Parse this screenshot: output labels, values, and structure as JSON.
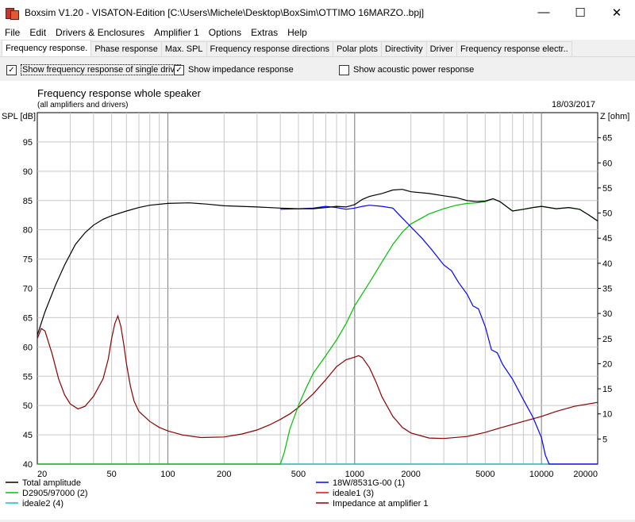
{
  "window": {
    "title": "Boxsim V1.20 - VISATON-Edition [C:\\Users\\Michele\\Desktop\\BoxSim\\OTTIMO 16MARZO..bpj]",
    "minimize": "—",
    "maximize": "☐",
    "close": "✕"
  },
  "menu": [
    "File",
    "Edit",
    "Drivers & Enclosures",
    "Amplifier 1",
    "Options",
    "Extras",
    "Help"
  ],
  "tabs": [
    {
      "label": "Frequency response.",
      "active": true
    },
    {
      "label": "Phase response",
      "active": false
    },
    {
      "label": "Max. SPL",
      "active": false
    },
    {
      "label": "Frequency response directions",
      "active": false
    },
    {
      "label": "Polar plots",
      "active": false
    },
    {
      "label": "Directivity",
      "active": false
    },
    {
      "label": "Driver",
      "active": false
    },
    {
      "label": "Frequency response electr..",
      "active": false
    }
  ],
  "options": [
    {
      "label": "Show frequency response of single drive",
      "checked": true
    },
    {
      "label": "Show impedance response",
      "checked": true
    },
    {
      "label": "Show acoustic power response",
      "checked": false
    }
  ],
  "checkmark": "✓",
  "chart_data": {
    "type": "line",
    "title": "Frequency response whole speaker",
    "subtitle": "(all amplifiers and drivers)",
    "date": "18/03/2017",
    "ylabel": "SPL [dB]",
    "y2label": "Z [ohm]",
    "xscale": "log",
    "xlim": [
      20,
      20000
    ],
    "ylim": [
      40,
      100
    ],
    "y2lim": [
      0,
      70
    ],
    "grid": true,
    "x_ticks": [
      20,
      50,
      100,
      200,
      500,
      1000,
      2000,
      5000,
      10000,
      20000
    ],
    "x_tick_labels": [
      "20",
      "50",
      "100",
      "200",
      "500",
      "1000",
      "2000",
      "5000",
      "10000",
      "20000"
    ],
    "y_ticks": [
      40,
      45,
      50,
      55,
      60,
      65,
      70,
      75,
      80,
      85,
      90,
      95
    ],
    "y_tick_labels": [
      "40",
      "45",
      "50",
      "55",
      "60",
      "65",
      "70",
      "75",
      "80",
      "85",
      "90",
      "95"
    ],
    "y2_ticks": [
      5,
      10,
      15,
      20,
      25,
      30,
      35,
      40,
      45,
      50,
      55,
      60,
      65
    ],
    "y2_tick_labels": [
      "5",
      "10",
      "15",
      "20",
      "25",
      "30",
      "35",
      "40",
      "45",
      "50",
      "55",
      "60",
      "65"
    ],
    "series": [
      {
        "name": "Total amplitude",
        "color": "#000000",
        "axis": "left",
        "x": [
          20,
          22,
          25,
          28,
          32,
          36,
          40,
          45,
          50,
          60,
          70,
          80,
          100,
          130,
          160,
          200,
          300,
          400,
          500,
          600,
          700,
          800,
          900,
          1000,
          1100,
          1200,
          1400,
          1600,
          1800,
          2000,
          2500,
          3000,
          3500,
          4000,
          4500,
          5000,
          5500,
          6000,
          7000,
          8000,
          9000,
          10000,
          12000,
          14000,
          16000,
          18000,
          20000
        ],
        "y": [
          62,
          66,
          70.5,
          74,
          77.5,
          79.5,
          80.8,
          81.8,
          82.4,
          83.2,
          83.8,
          84.2,
          84.5,
          84.6,
          84.4,
          84.1,
          83.9,
          83.7,
          83.6,
          83.6,
          83.8,
          84,
          83.9,
          84.3,
          85.2,
          85.7,
          86.2,
          86.8,
          86.9,
          86.5,
          86.2,
          85.8,
          85.5,
          85,
          84.8,
          84.9,
          85.3,
          84.8,
          83.2,
          83.5,
          83.8,
          84,
          83.6,
          83.8,
          83.5,
          82.5,
          81.5
        ]
      },
      {
        "name": "18W/8531G-00 (1)",
        "color": "#0000ff",
        "axis": "left",
        "x": [
          400,
          500,
          600,
          700,
          800,
          900,
          1000,
          1100,
          1200,
          1400,
          1600,
          1800,
          2000,
          2300,
          2600,
          3000,
          3300,
          3600,
          4000,
          4300,
          4600,
          5000,
          5400,
          5800,
          6200,
          7000,
          8000,
          9000,
          10000,
          10500,
          11000,
          12000,
          20000
        ],
        "y": [
          83.5,
          83.6,
          83.7,
          84,
          83.8,
          83.5,
          83.7,
          84,
          84.2,
          84,
          83.7,
          82,
          80.5,
          78.5,
          76.5,
          74,
          73,
          71,
          69,
          67,
          66.5,
          63.5,
          59.5,
          59,
          57,
          54.5,
          51,
          48,
          44.5,
          41.5,
          40,
          40,
          40
        ]
      },
      {
        "name": "D2905/97000 (2)",
        "color": "#00c000",
        "axis": "left",
        "x": [
          20,
          400,
          420,
          450,
          500,
          550,
          600,
          700,
          800,
          900,
          1000,
          1200,
          1400,
          1600,
          1800,
          2000,
          2500,
          3000,
          3500,
          4000,
          4500,
          5000,
          5500,
          6000,
          7000,
          8000,
          9000,
          10000,
          12000,
          14000,
          16000,
          18000,
          20000
        ],
        "y": [
          40,
          40,
          42,
          46,
          50,
          53,
          55.5,
          58.5,
          61.2,
          64,
          67,
          71,
          74.5,
          77.5,
          79.6,
          81,
          82.7,
          83.6,
          84.2,
          84.5,
          84.6,
          84.8,
          85.3,
          84.8,
          83.2,
          83.5,
          83.8,
          84,
          83.6,
          83.8,
          83.5,
          82.5,
          81.5
        ]
      },
      {
        "name": "ideale1 (3)",
        "color": "#ff0000",
        "axis": "left",
        "x": [
          20,
          20000
        ],
        "y": [
          40,
          40
        ]
      },
      {
        "name": "ideale2 (4)",
        "color": "#00c8c8",
        "axis": "left",
        "x": [
          20,
          20000
        ],
        "y": [
          40,
          40
        ]
      },
      {
        "name": "Impedance at amplifier 1",
        "color": "#8b0000",
        "axis": "right",
        "x": [
          20,
          21,
          22,
          24,
          26,
          28,
          30,
          33,
          36,
          40,
          45,
          48,
          50,
          52,
          54,
          56,
          58,
          60,
          63,
          66,
          70,
          80,
          90,
          100,
          120,
          150,
          200,
          250,
          300,
          350,
          400,
          450,
          500,
          600,
          700,
          800,
          900,
          1000,
          1050,
          1100,
          1200,
          1300,
          1400,
          1600,
          1800,
          2000,
          2500,
          3000,
          4000,
          5000,
          6000,
          8000,
          10000,
          12000,
          15000,
          20000
        ],
        "y": [
          25,
          27,
          26.5,
          22,
          17,
          13.8,
          12,
          11,
          11.5,
          13.5,
          17,
          21,
          25,
          28,
          29.5,
          27.5,
          24,
          20,
          15.5,
          12.5,
          10.5,
          8.5,
          7.3,
          6.6,
          5.8,
          5.3,
          5.4,
          6,
          6.8,
          7.8,
          8.9,
          10,
          11.3,
          14,
          16.8,
          19.4,
          20.8,
          21.3,
          21.6,
          21.2,
          19.2,
          16.4,
          13.4,
          9.5,
          7.3,
          6.2,
          5.2,
          5.1,
          5.5,
          6.3,
          7.2,
          8.5,
          9.5,
          10.5,
          11.5,
          12.3
        ]
      }
    ]
  }
}
